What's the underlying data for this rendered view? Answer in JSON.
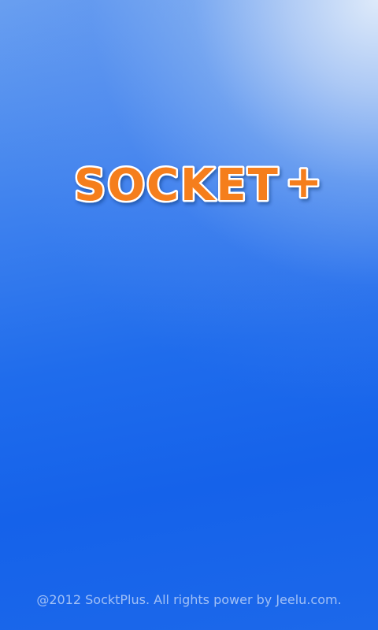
{
  "splash": {
    "logo_text": "SOCKET",
    "logo_symbol": "+",
    "footer": "@2012 SocktPlus. All rights power by Jeelu.com."
  },
  "colors": {
    "logo_orange": "#f57e1e",
    "logo_outline": "#ffffff",
    "background_top_right": "#dfeafb",
    "background_main": "#1a66ec"
  }
}
